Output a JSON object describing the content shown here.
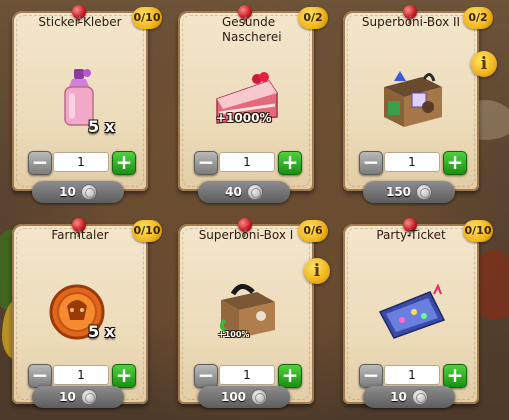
{
  "cards": [
    {
      "title": "Sticker-Kleber",
      "count": "0/10",
      "quantity": "1",
      "price": "10",
      "multiplier": "5 x",
      "bonus": "",
      "info": false,
      "icon": "pink-glue-bottle-icon"
    },
    {
      "title": "Gesunde Nascherei",
      "count": "0/2",
      "quantity": "1",
      "price": "40",
      "multiplier": "",
      "bonus": "+1000%",
      "info": false,
      "icon": "cake-slice-icon"
    },
    {
      "title": "Superboni-Box II",
      "count": "0/2",
      "quantity": "1",
      "price": "150",
      "multiplier": "",
      "bonus": "",
      "info": true,
      "icon": "bonus-box-icon"
    },
    {
      "title": "Farmtaler",
      "count": "0/10",
      "quantity": "1",
      "price": "10",
      "multiplier": "5 x",
      "bonus": "",
      "info": false,
      "icon": "farm-coin-icon"
    },
    {
      "title": "Superboni-Box I",
      "count": "0/6",
      "quantity": "1",
      "price": "100",
      "multiplier": "",
      "bonus": "+100%",
      "info": true,
      "icon": "bonus-crate-icon"
    },
    {
      "title": "Party-Ticket",
      "count": "0/10",
      "quantity": "1",
      "price": "10",
      "multiplier": "",
      "bonus": "",
      "info": false,
      "icon": "party-ticket-icon"
    }
  ],
  "colors": {
    "plus": "#2aa81c",
    "minus": "#8f8f8f",
    "badge": "#f1b41a",
    "paper": "#f0e2c4"
  },
  "info_symbol": "i",
  "minus_symbol": "−",
  "plus_symbol": "+"
}
